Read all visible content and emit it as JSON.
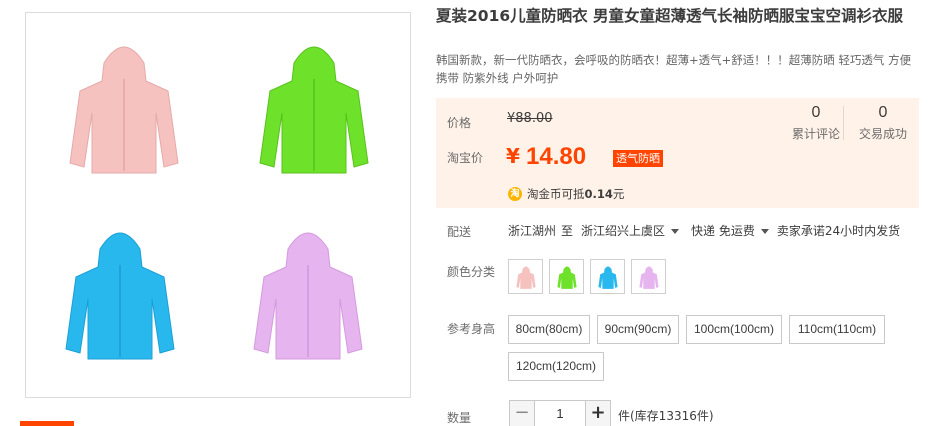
{
  "product": {
    "title": "夏装2016儿童防晒衣 男童女童超薄透气长袖防晒服宝宝空调衫衣服",
    "subtitle": "韩国新款，新一代防晒衣，会呼吸的防晒衣！超薄+透气+舒适！！！超薄防晒 轻巧透气 方便携带 防紫外线 户外呵护",
    "gallery_jackets": [
      {
        "name": "pink-jacket",
        "color": "#f5c2c0"
      },
      {
        "name": "green-jacket",
        "color": "#6ee12a"
      },
      {
        "name": "blue-jacket",
        "color": "#29b8ee"
      },
      {
        "name": "purple-jacket",
        "color": "#e6b4ee"
      }
    ]
  },
  "price": {
    "orig_label": "价格",
    "orig_value": "¥88.00",
    "current_label": "淘宝价",
    "currency": "¥",
    "current_value": "14.80",
    "promo_tag": "透气防晒",
    "coin_icon": "淘",
    "coin_text_prefix": "淘金币可抵",
    "coin_amount": "0.14",
    "coin_unit": "元",
    "reviews_count": "0",
    "reviews_label": "累计评论",
    "sales_count": "0",
    "sales_label": "交易成功",
    "accent": "#ff4400"
  },
  "shipping": {
    "label": "配送",
    "from": "浙江湖州",
    "to_word": "至",
    "destination": "浙江绍兴上虞区",
    "method": "快递 免运费",
    "promise": "卖家承诺24小时内发货"
  },
  "color": {
    "label": "颜色分类",
    "options": [
      {
        "name": "pink",
        "color": "#f5c2c0"
      },
      {
        "name": "green",
        "color": "#6ee12a"
      },
      {
        "name": "blue",
        "color": "#29b8ee"
      },
      {
        "name": "purple",
        "color": "#e6b4ee"
      }
    ]
  },
  "size": {
    "label": "参考身高",
    "options": [
      "80cm(80cm)",
      "90cm(90cm)",
      "100cm(100cm)",
      "110cm(110cm)",
      "120cm(120cm)"
    ]
  },
  "quantity": {
    "label": "数量",
    "minus": "−",
    "value": "1",
    "plus": "+",
    "stock_text": "件(库存13316件)"
  }
}
